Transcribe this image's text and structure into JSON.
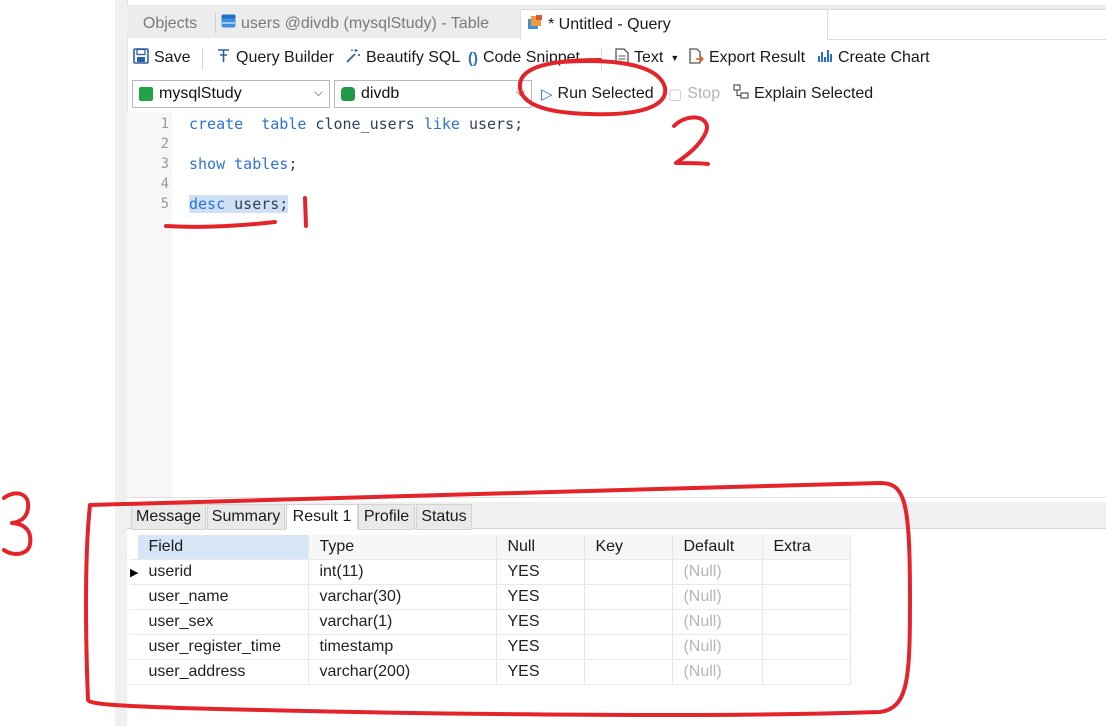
{
  "tabs": {
    "objects": "Objects",
    "users_table": "users @divdb (mysqlStudy) - Table",
    "untitled_query": "* Untitled - Query"
  },
  "toolbar": {
    "save": "Save",
    "query_builder": "Query Builder",
    "beautify_sql": "Beautify SQL",
    "code_snippet": "Code Snippet",
    "text": "Text",
    "export_result": "Export Result",
    "create_chart": "Create Chart"
  },
  "row2": {
    "connection": "mysqlStudy",
    "database": "divdb",
    "run_selected": "Run Selected",
    "stop": "Stop",
    "explain_selected": "Explain Selected"
  },
  "editor": {
    "lines": [
      {
        "n": "1",
        "parts": [
          [
            "kw",
            "create"
          ],
          [
            "sp",
            "  "
          ],
          [
            "kw",
            "table"
          ],
          [
            "id",
            " clone_users "
          ],
          [
            "kw",
            "like"
          ],
          [
            "id",
            " users;"
          ]
        ]
      },
      {
        "n": "2",
        "parts": []
      },
      {
        "n": "3",
        "parts": [
          [
            "kw",
            "show"
          ],
          [
            "sp",
            " "
          ],
          [
            "kw",
            "tables"
          ],
          [
            "id",
            ";"
          ]
        ]
      },
      {
        "n": "4",
        "parts": []
      },
      {
        "n": "5",
        "parts": [
          [
            "kw",
            "desc"
          ],
          [
            "id",
            " users;"
          ]
        ]
      }
    ]
  },
  "results": {
    "tabs": [
      "Message",
      "Summary",
      "Result 1",
      "Profile",
      "Status"
    ],
    "active_tab": "Result 1",
    "columns": [
      "Field",
      "Type",
      "Null",
      "Key",
      "Default",
      "Extra"
    ],
    "rows": [
      [
        "userid",
        "int(11)",
        "YES",
        "",
        "(Null)",
        ""
      ],
      [
        "user_name",
        "varchar(30)",
        "YES",
        "",
        "(Null)",
        ""
      ],
      [
        "user_sex",
        "varchar(1)",
        "YES",
        "",
        "(Null)",
        ""
      ],
      [
        "user_register_time",
        "timestamp",
        "YES",
        "",
        "(Null)",
        ""
      ],
      [
        "user_address",
        "varchar(200)",
        "YES",
        "",
        "(Null)",
        ""
      ]
    ]
  },
  "annotations": {
    "mark1": "1",
    "mark2": "2",
    "mark3": "3"
  },
  "colors": {
    "annotation": "#e3242b",
    "keyword": "#2b73d6",
    "selection": "#cfe0f5"
  }
}
